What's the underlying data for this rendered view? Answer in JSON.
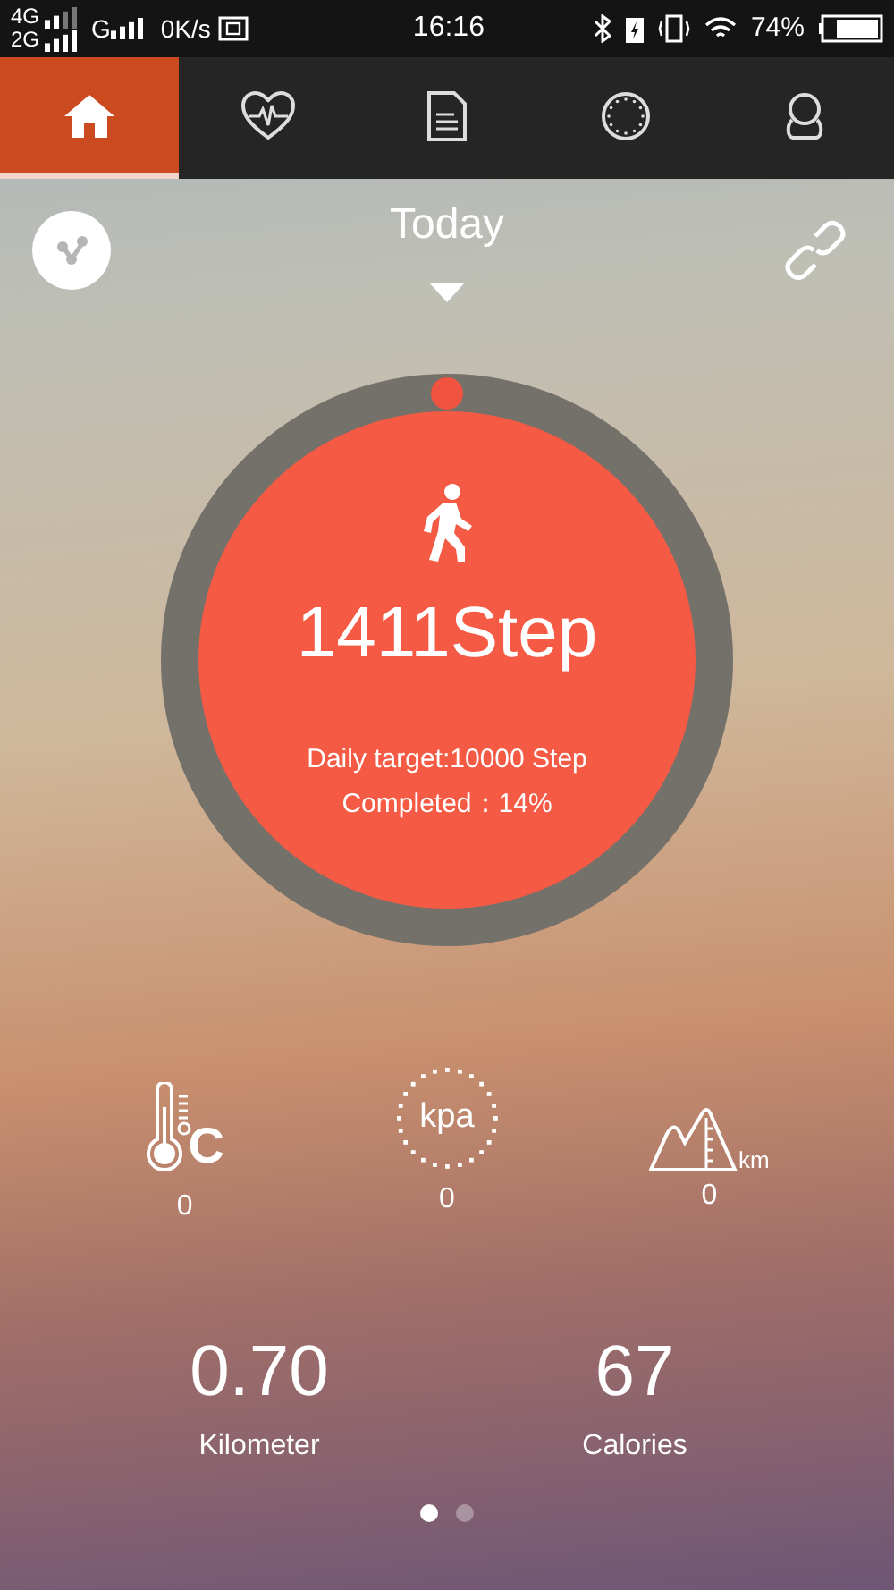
{
  "status_bar": {
    "network_top": "4G",
    "network_bottom": "2G",
    "network_extra": "G",
    "speed": "0K/s",
    "time": "16:16",
    "battery": "74%"
  },
  "tabs": [
    {
      "kind": "home",
      "selected": true
    },
    {
      "kind": "heart",
      "selected": false
    },
    {
      "kind": "document",
      "selected": false
    },
    {
      "kind": "dial",
      "selected": false
    },
    {
      "kind": "profile",
      "selected": false
    }
  ],
  "header": {
    "title": "Today"
  },
  "steps": {
    "count": "1411Step",
    "target": "Daily target:10000 Step",
    "completed": "Completed：14%"
  },
  "sensors": [
    {
      "kind": "temperature",
      "unit": "C",
      "value": "0"
    },
    {
      "kind": "pressure",
      "unit": "kpa",
      "value": "0"
    },
    {
      "kind": "altitude",
      "unit": "km",
      "value": "0"
    }
  ],
  "stats": [
    {
      "value": "0.70",
      "label": "Kilometer"
    },
    {
      "value": "67",
      "label": "Calories"
    }
  ],
  "pages": [
    {
      "selected": true
    },
    {
      "selected": false
    }
  ]
}
